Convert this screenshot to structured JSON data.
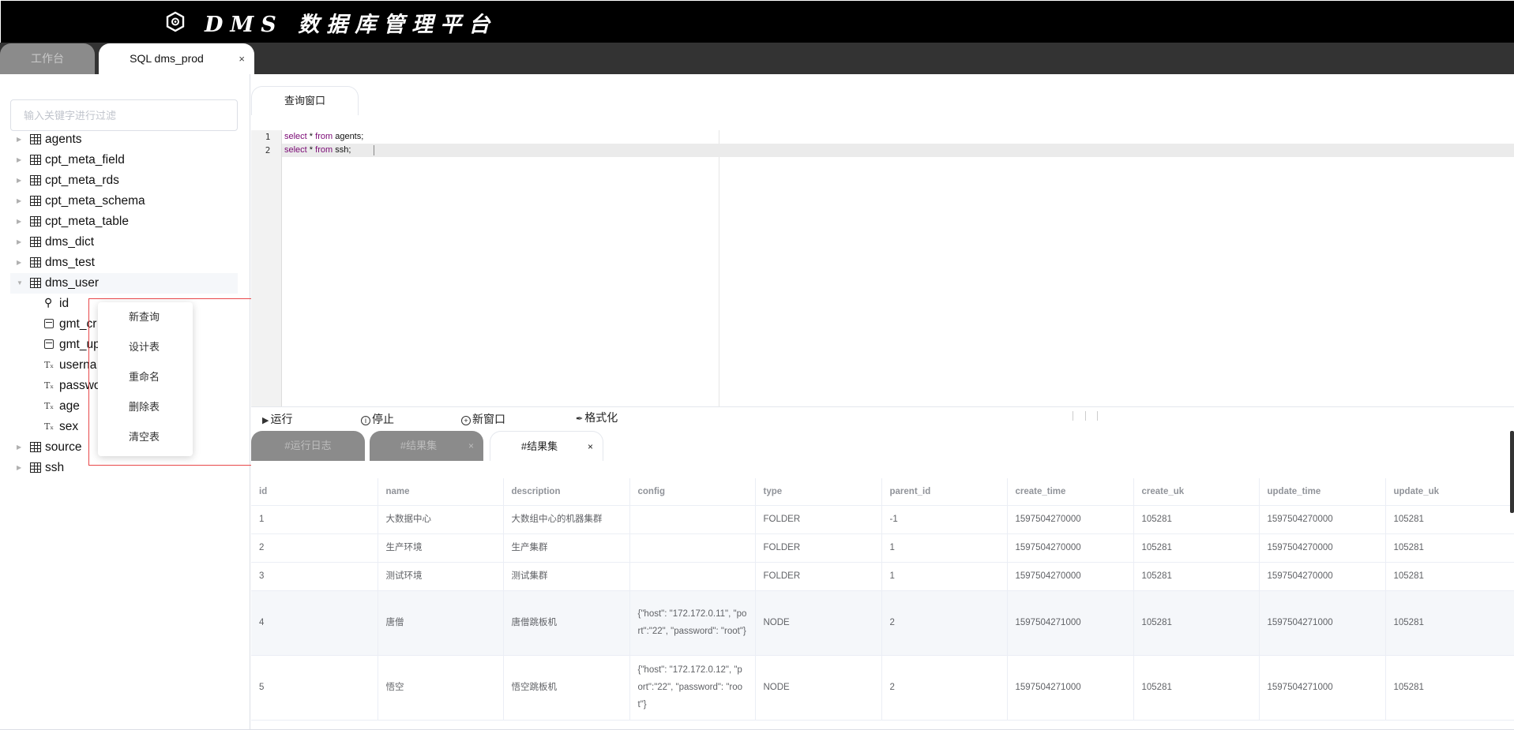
{
  "app": {
    "title": "DMS 数据库管理平台"
  },
  "top_tabs": [
    {
      "label": "工作台"
    },
    {
      "label": "SQL dms_prod",
      "close": "×"
    }
  ],
  "sidebar": {
    "filter_placeholder": "输入关键字进行过滤",
    "tables": [
      {
        "name": "agents"
      },
      {
        "name": "cpt_meta_field"
      },
      {
        "name": "cpt_meta_rds"
      },
      {
        "name": "cpt_meta_schema"
      },
      {
        "name": "cpt_meta_table"
      },
      {
        "name": "dms_dict"
      },
      {
        "name": "dms_test"
      },
      {
        "name": "dms_user",
        "expanded": true,
        "columns": [
          {
            "name": "id",
            "icon": "key-icon"
          },
          {
            "name": "gmt_cr",
            "icon": "date-icon"
          },
          {
            "name": "gmt_up",
            "icon": "date-icon"
          },
          {
            "name": "userna",
            "icon": "text-icon"
          },
          {
            "name": "passwo",
            "icon": "text-icon"
          },
          {
            "name": "age",
            "icon": "text-icon"
          },
          {
            "name": "sex",
            "icon": "text-icon"
          }
        ]
      },
      {
        "name": "source"
      },
      {
        "name": "ssh"
      }
    ]
  },
  "context_menu": {
    "items": [
      "新查询",
      "设计表",
      "重命名",
      "删除表",
      "清空表"
    ]
  },
  "editor": {
    "tab_label": "查询窗口",
    "lines": [
      {
        "num": "1",
        "kw1": "select",
        "mid": " * ",
        "kw2": "from",
        "rest": " agents;"
      },
      {
        "num": "2",
        "kw1": "select",
        "mid": " * ",
        "kw2": "from",
        "rest": " ssh;"
      }
    ]
  },
  "toolbar": {
    "run": "运行",
    "stop": "停止",
    "new_window": "新窗口",
    "format": "格式化"
  },
  "result_tabs": [
    {
      "label": "#运行日志"
    },
    {
      "label": "#结果集",
      "close": "×"
    },
    {
      "label": "#结果集",
      "close": "×"
    }
  ],
  "result_table": {
    "columns": [
      "id",
      "name",
      "description",
      "config",
      "type",
      "parent_id",
      "create_time",
      "create_uk",
      "update_time",
      "update_uk"
    ],
    "rows": [
      [
        "1",
        "大数据中心",
        "大数组中心的机器集群",
        "",
        "FOLDER",
        "-1",
        "1597504270000",
        "105281",
        "1597504270000",
        "105281"
      ],
      [
        "2",
        "生产环境",
        "生产集群",
        "",
        "FOLDER",
        "1",
        "1597504270000",
        "105281",
        "1597504270000",
        "105281"
      ],
      [
        "3",
        "测试环境",
        "测试集群",
        "",
        "FOLDER",
        "1",
        "1597504270000",
        "105281",
        "1597504270000",
        "105281"
      ],
      [
        "4",
        "唐僧",
        "唐僧跳板机",
        "{\"host\": \"172.172.0.11\", \"port\":\"22\", \"password\": \"root\"}",
        "NODE",
        "2",
        "1597504271000",
        "105281",
        "1597504271000",
        "105281"
      ],
      [
        "5",
        "悟空",
        "悟空跳板机",
        "{\"host\": \"172.172.0.12\", \"port\":\"22\", \"password\": \"root\"}",
        "NODE",
        "2",
        "1597504271000",
        "105281",
        "1597504271000",
        "105281"
      ]
    ]
  }
}
